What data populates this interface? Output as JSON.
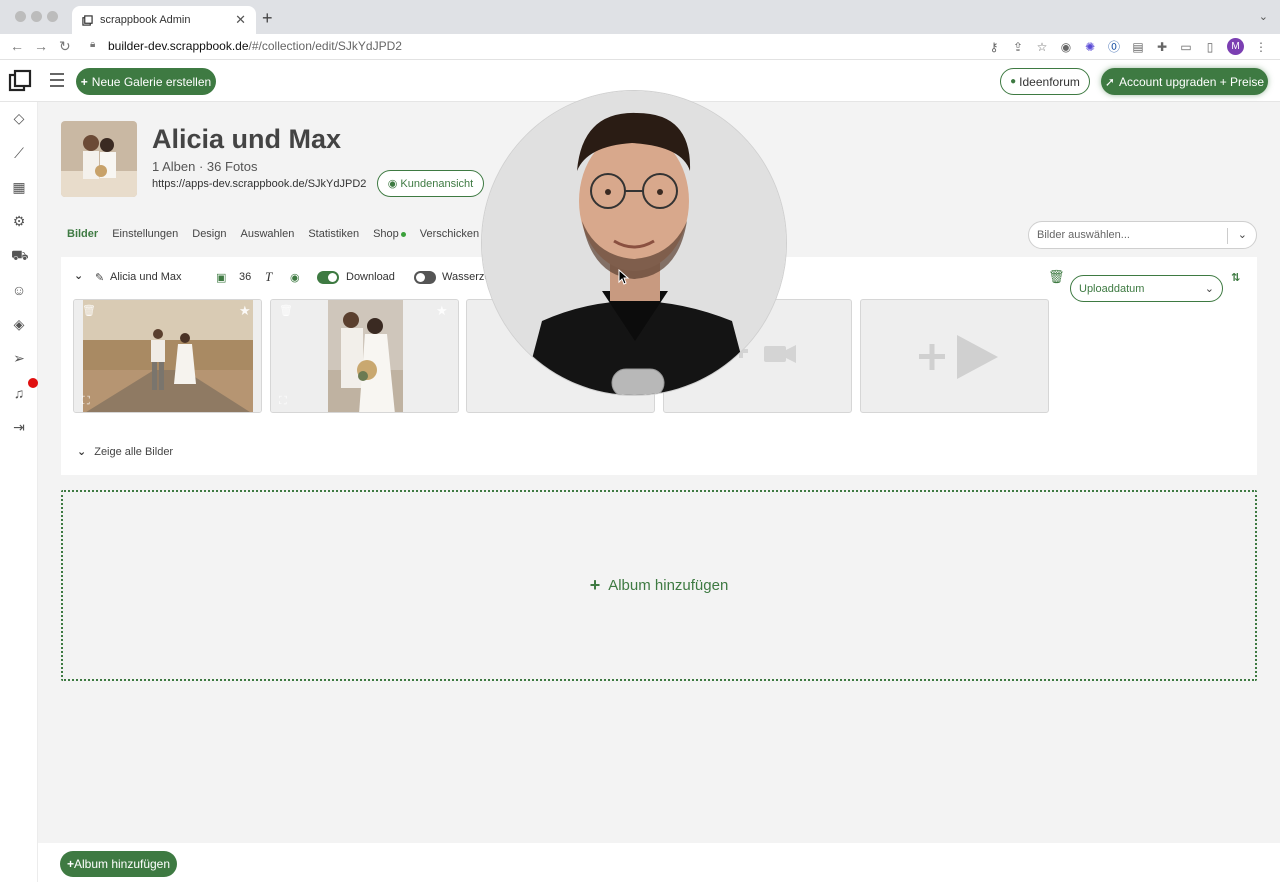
{
  "browser": {
    "tab_title": "scrappbook Admin",
    "url_host": "builder-dev.scrappbook.de",
    "url_path": "/#/collection/edit/SJkYdJPD2",
    "profile_initial": "M"
  },
  "topbar": {
    "new_gallery_label": "Neue Galerie erstellen",
    "ideas_label": "Ideenforum",
    "upgrade_label": "Account upgraden + Preise"
  },
  "collection": {
    "title": "Alicia und Max",
    "subtitle": "1 Alben · 36 Fotos",
    "link": "https://apps-dev.scrappbook.de/SJkYdJPD2",
    "client_view_label": "Kundenansicht"
  },
  "tabs": [
    "Bilder",
    "Einstellungen",
    "Design",
    "Auswahlen",
    "Statistiken",
    "Shop",
    "Verschicken"
  ],
  "select_images_placeholder": "Bilder auswählen...",
  "album": {
    "name": "Alicia und Max",
    "count": "36",
    "download_label": "Download",
    "watermark_label": "Wasserze",
    "sort_label": "Uploaddatum",
    "show_all_label": "Zeige alle Bilder"
  },
  "add_album_label": "Album hinzufügen",
  "bottom_add_album_label": "Album hinzufügen",
  "colors": {
    "brand_green": "#3e7a42",
    "notification_red": "#e01010"
  }
}
